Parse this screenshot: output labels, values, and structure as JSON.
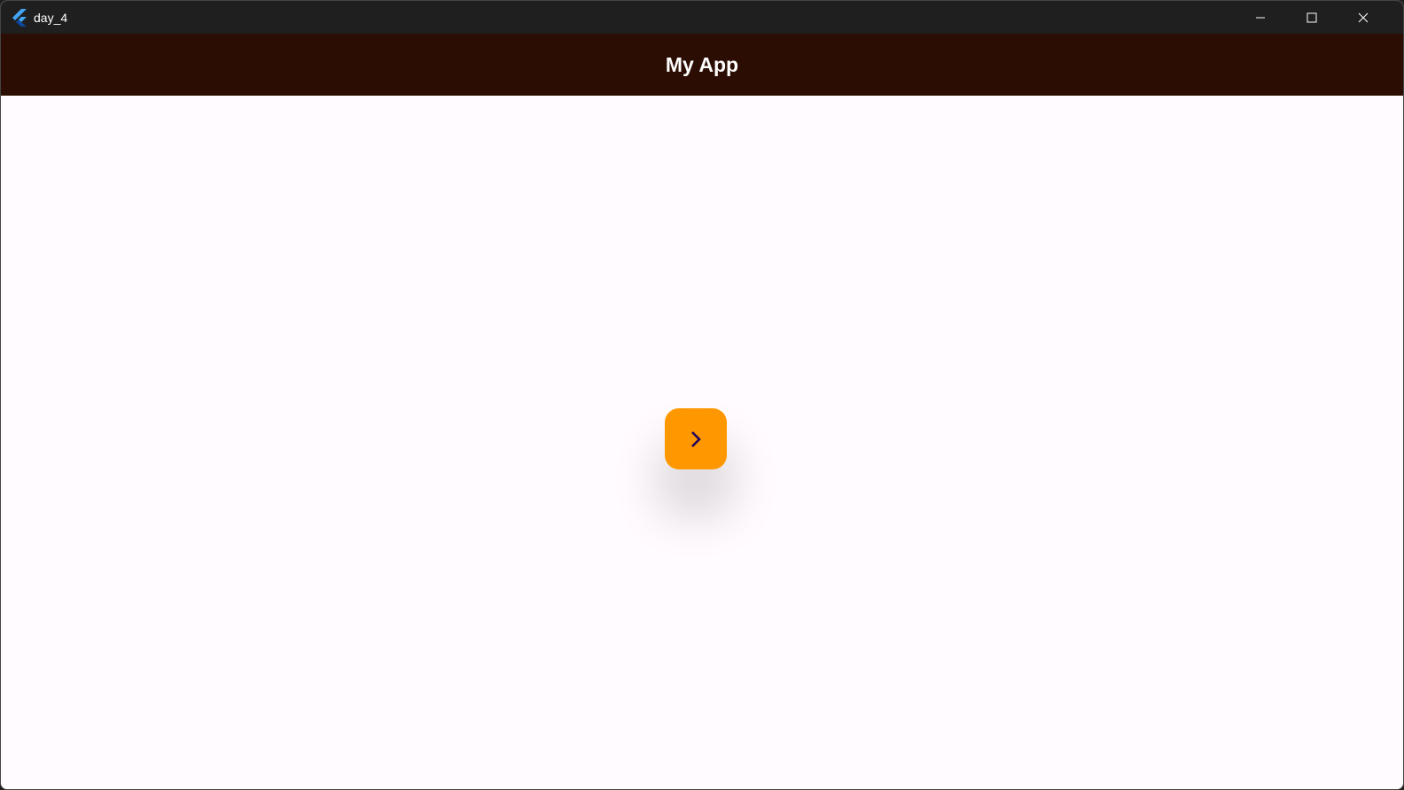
{
  "window": {
    "title": "day_4",
    "icon": "flutter-logo-icon"
  },
  "controls": {
    "minimize": "minimize-icon",
    "maximize": "maximize-icon",
    "close": "close-icon"
  },
  "appbar": {
    "title": "My App",
    "color": "#2c0d03"
  },
  "fab": {
    "icon": "chevron-right-icon",
    "color": "#ff9800",
    "icon_color": "#21005d"
  }
}
